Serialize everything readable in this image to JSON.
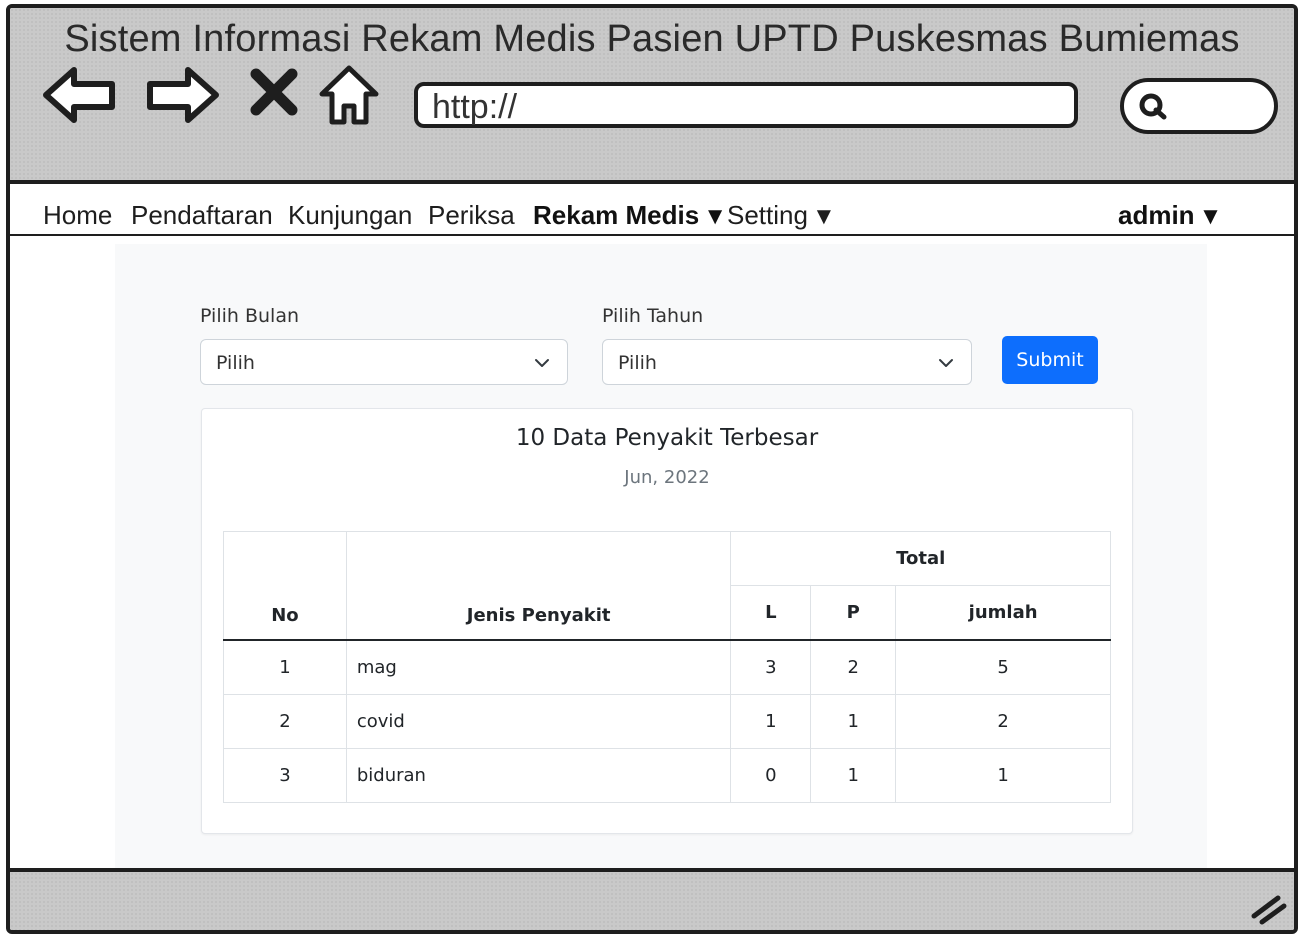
{
  "window": {
    "title": "Sistem Informasi Rekam Medis Pasien UPTD Puskesmas Bumiemas",
    "address": "http://"
  },
  "menu": {
    "items": [
      {
        "label": "Home"
      },
      {
        "label": "Pendaftaran"
      },
      {
        "label": "Kunjungan"
      },
      {
        "label": "Periksa"
      },
      {
        "label": "Rekam Medis"
      },
      {
        "label": "Setting"
      }
    ],
    "user": "admin",
    "caret": "▼"
  },
  "filter": {
    "month_label": "Pilih Bulan",
    "month_value": "Pilih",
    "year_label": "Pilih Tahun",
    "year_value": "Pilih",
    "submit_label": "Submit"
  },
  "report": {
    "title": "10 Data Penyakit Terbesar",
    "period": "Jun, 2022",
    "headers": {
      "no": "No",
      "disease": "Jenis Penyakit",
      "total": "Total",
      "male": "L",
      "female": "P",
      "sum": "jumlah"
    },
    "rows": [
      {
        "no": "1",
        "disease": "mag",
        "l": "3",
        "p": "2",
        "jumlah": "5"
      },
      {
        "no": "2",
        "disease": "covid",
        "l": "1",
        "p": "1",
        "jumlah": "2"
      },
      {
        "no": "3",
        "disease": "biduran",
        "l": "0",
        "p": "1",
        "jumlah": "1"
      }
    ]
  },
  "colors": {
    "primary": "#0d6efd",
    "chrome": "#c9c9c9"
  }
}
